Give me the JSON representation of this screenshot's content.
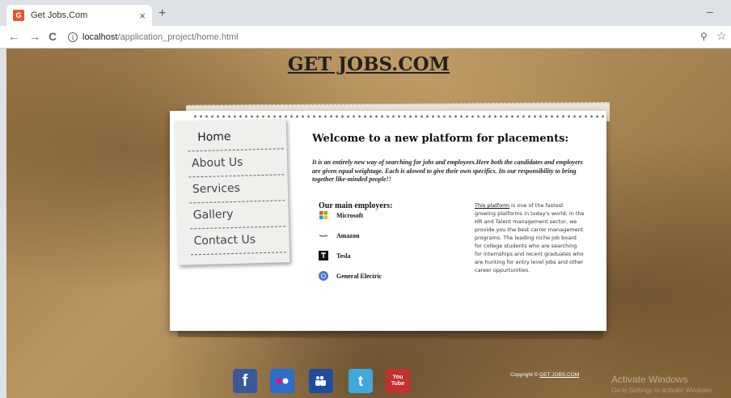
{
  "browser": {
    "tab_title": "Get Jobs.Com",
    "tab_close": "×",
    "new_tab": "+",
    "minimize": "–",
    "back": "←",
    "forward": "→",
    "reload": "C",
    "info_glyph": "i",
    "url_host": "localhost",
    "url_path": "/application_project/home.html",
    "zoom_glyph": "⚲",
    "star_glyph": "☆"
  },
  "site": {
    "title": "GET JOBS.COM"
  },
  "menu": {
    "items": [
      "Home",
      "About Us",
      "Services",
      "Gallery",
      "Contact Us"
    ]
  },
  "main": {
    "welcome": "Welcome to a new platform for placements:",
    "intro": "It is an entirely new way of searching for jobs and employees.Here both the candidates and employers are given equal weightage. Each is alowed to give their own specifics. Its our responsibility to bring together like-minded people!!",
    "employers_heading": "Our main employers:",
    "employers": [
      "Microsoft",
      "Amazon",
      "Tesla",
      "General Electric"
    ],
    "side_link": "This platform",
    "side_text": " is one of the fastest growing platforms in today's world, in the HR and Talent management sector, we provide you the best carrer management programs. The leading niche job board for college students who are searching for internships and recent graduates who are hunting for entry level jobs and other career oppurtunities."
  },
  "footer": {
    "social": [
      "f",
      "••",
      "ⵗ",
      "t",
      "You Tube"
    ],
    "copyright_prefix": "Copyright © ",
    "copyright_link": "GET JOBS.COM",
    "activate_title": "Activate Windows",
    "activate_sub": "Go to Settings to activate Windows."
  },
  "colors": {
    "facebook": "#3b5998",
    "flickr": "#2a6fc9",
    "myspace": "#1d4e9e",
    "twitter": "#3fa9dd",
    "youtube": "#c4302b"
  }
}
